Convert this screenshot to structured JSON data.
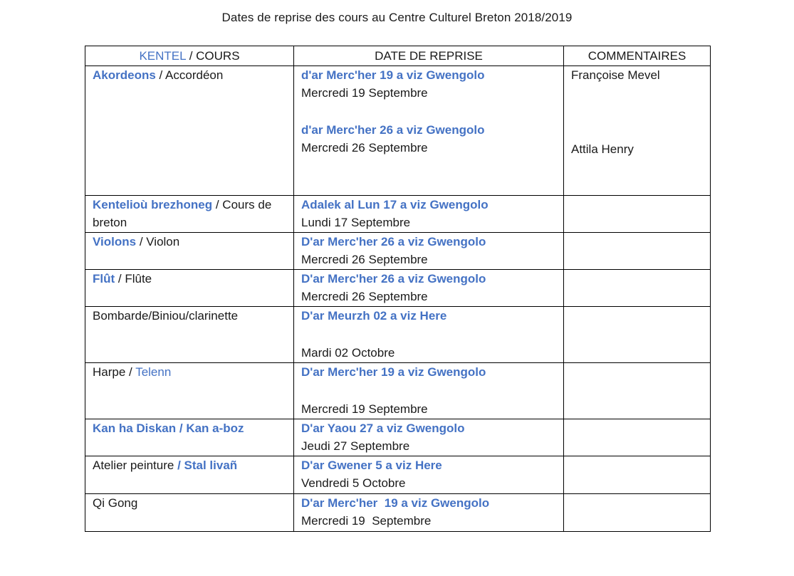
{
  "title": "Dates de reprise des cours au Centre Culturel Breton 2018/2019",
  "header": {
    "col1_blue": "KENTEL",
    "col1_rest": " / COURS",
    "col2": "DATE DE REPRISE",
    "col3": "COMMENTAIRES"
  },
  "rows": [
    {
      "course_breton": "Akordeons",
      "course_sep": " / ",
      "course_french": "Accordéon",
      "date1_breton": "d'ar Merc'her 19 a viz Gwengolo",
      "date1_french": "Mercredi 19 Septembre",
      "date2_breton": "d'ar Merc'her 26 a viz Gwengolo",
      "date2_french": "Mercredi 26 Septembre",
      "comment1": "Françoise Mevel",
      "comment2": "Attila Henry"
    },
    {
      "course_breton": "Kentelioù brezhoneg",
      "course_sep": " / ",
      "course_french": "Cours de breton",
      "date_breton": "Adalek al Lun 17 a viz Gwengolo",
      "date_french": "Lundi 17 Septembre"
    },
    {
      "course_breton": "Violons",
      "course_sep": " / ",
      "course_french": "Violon",
      "date_breton": "D'ar Merc'her 26 a viz Gwengolo",
      "date_french": "Mercredi 26 Septembre"
    },
    {
      "course_breton": "Flût",
      "course_sep": " / ",
      "course_french": "Flûte",
      "date_breton": "D'ar Merc'her 26 a viz Gwengolo",
      "date_french": "Mercredi 26 Septembre"
    },
    {
      "course_text": "Bombarde/Biniou/clarinette",
      "date_breton": "D'ar Meurzh 02 a viz Here",
      "date_french": "Mardi 02 Octobre"
    },
    {
      "course_french": "Harpe",
      "course_sep": " / ",
      "course_breton": "Telenn",
      "date_breton": "D'ar Merc'her 19 a viz Gwengolo",
      "date_french": "Mercredi 19 Septembre"
    },
    {
      "course_text": "Kan ha Diskan / Kan a-boz",
      "date_breton": "D'ar Yaou 27 a viz Gwengolo",
      "date_french": "Jeudi 27 Septembre"
    },
    {
      "course_french": "Atelier peinture ",
      "course_breton": "/ Stal livañ",
      "date_breton": "D'ar Gwener 5 a viz Here",
      "date_french": "Vendredi 5 Octobre"
    },
    {
      "course_text": "Qi Gong",
      "date_breton": "D'ar Merc'her  19 a viz Gwengolo",
      "date_french": "Mercredi 19  Septembre"
    }
  ]
}
